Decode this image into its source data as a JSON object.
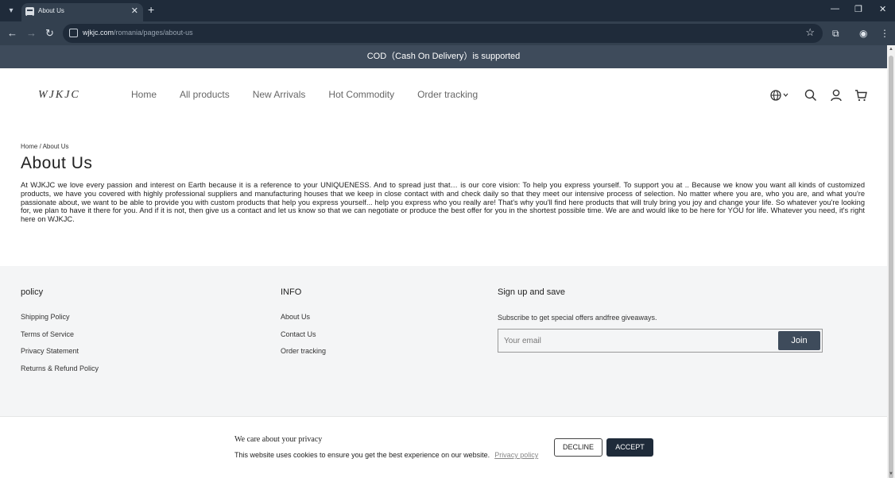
{
  "browser": {
    "tab_title": "About Us",
    "url_host": "wjkjc.com",
    "url_path": "/romania/pages/about-us",
    "icons": {
      "tab_menu": "chevron-down-icon",
      "tab_close": "close-icon",
      "new_tab": "plus-icon",
      "minimize": "minimize-icon",
      "restore": "restore-icon",
      "close_window": "close-icon",
      "back": "arrow-left-icon",
      "forward": "arrow-right-icon",
      "reload": "reload-icon",
      "site_info": "site-settings-icon",
      "bookmark": "star-icon",
      "extensions": "puzzle-icon",
      "profile": "profile-icon",
      "menu": "kebab-menu-icon"
    }
  },
  "announcement": "COD（Cash On Delivery）is supported",
  "header": {
    "logo_text": "WJKJC",
    "nav": [
      "Home",
      "All products",
      "New Arrivals",
      "Hot Commodity",
      "Order tracking"
    ],
    "icons": [
      "globe-icon",
      "search-icon",
      "user-icon",
      "cart-icon"
    ]
  },
  "breadcrumb": {
    "home": "Home",
    "separator": "/",
    "current": "About Us"
  },
  "page": {
    "title": "About Us",
    "body": "At  WJKJC we love every passion and interest on Earth because it is a reference to your UNIQUENESS. And to spread just that… is our core vision: To help you express yourself. To support you at .. Because we know you want all kinds of customized products, we have you covered with highly professional suppliers and manufacturing houses that we keep in close contact with and check daily so that they meet our intensive process of selection. No matter where you are, who you are, and what you're passionate about, we want to be able to provide you with custom products that help you express yourself... help you express who you really are! That's why you'll find here products that will truly bring you joy and change your life. So whatever you're looking for, we plan to have it there for you. And if it is not, then give us a contact and let us know so that we can negotiate or produce the best offer for you in the shortest possible time. We are and would like to be here for YOU for life. Whatever you need, it's right here on WJKJC."
  },
  "footer": {
    "policy": {
      "heading": "policy",
      "links": [
        "Shipping Policy",
        "Terms of Service",
        "Privacy Statement",
        "Returns & Refund Policy"
      ]
    },
    "info": {
      "heading": "INFO",
      "links": [
        "About Us",
        "Contact Us",
        "Order tracking"
      ]
    },
    "signup": {
      "heading": "Sign up and save",
      "subtitle": "Subscribe to get special offers andfree giveaways.",
      "email_placeholder": "Your email",
      "join_label": "Join"
    }
  },
  "cookie": {
    "title": "We care about your privacy",
    "text": "This website uses cookies to ensure you get the best experience on our website.",
    "link": "Privacy policy",
    "decline": "DECLINE",
    "accept": "ACCEPT"
  },
  "colors": {
    "chrome_dark": "#1f2b3a",
    "chrome_toolbar": "#33404f",
    "announcement_bg": "#3e4b5b",
    "footer_bg": "#f4f5f6",
    "accept_bg": "#1f2b3a"
  }
}
